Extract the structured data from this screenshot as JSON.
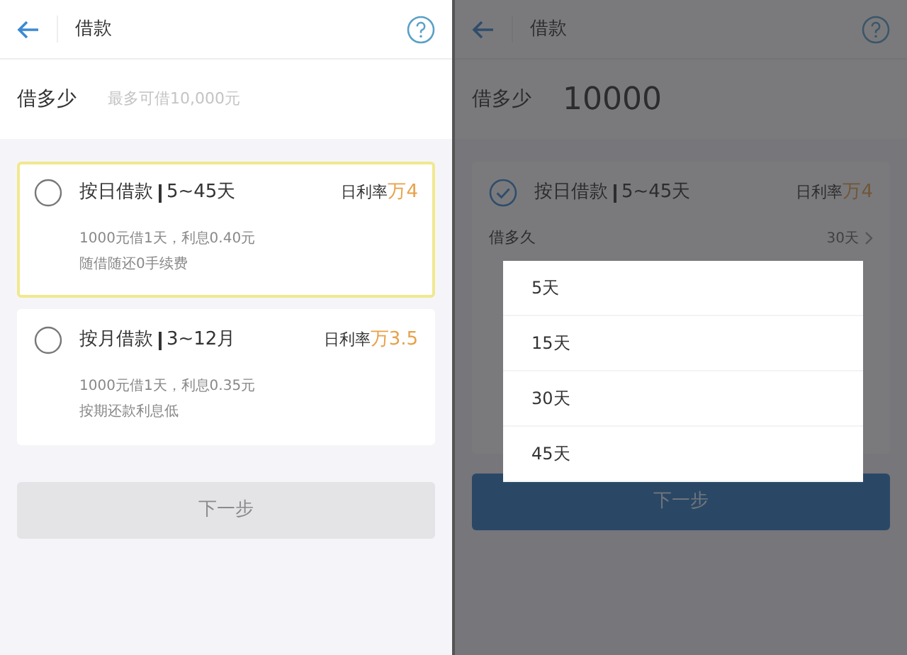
{
  "screens": [
    {
      "title": "借款",
      "amount": {
        "label": "借多少",
        "placeholder": "最多可借10,000元"
      },
      "plans": [
        {
          "name": "按日借款",
          "range": "5~45天",
          "rate_label": "日利率",
          "rate_value": "万4",
          "lines": [
            "1000元借1天，利息0.40元",
            "随借随还0手续费"
          ],
          "selected": false,
          "focused": true
        },
        {
          "name": "按月借款",
          "range": "3~12月",
          "rate_label": "日利率",
          "rate_value": "万3.5",
          "lines": [
            "1000元借1天，利息0.35元",
            "按期还款利息低"
          ],
          "selected": false,
          "focused": false
        }
      ],
      "button": {
        "label": "下一步",
        "disabled": true
      }
    },
    {
      "title": "借款",
      "amount": {
        "label": "借多少",
        "value": "10000"
      },
      "plans": [
        {
          "name": "按日借款",
          "range": "5~45天",
          "rate_label": "日利率",
          "rate_value": "万4",
          "selected": true,
          "focused": false,
          "duration": {
            "label": "借多久",
            "value": "30天"
          }
        }
      ],
      "button": {
        "label": "下一步",
        "disabled": false
      },
      "picker": {
        "options": [
          {
            "label": "5天"
          },
          {
            "label": "15天"
          },
          {
            "label": "30天"
          },
          {
            "label": "45天"
          }
        ]
      }
    }
  ]
}
